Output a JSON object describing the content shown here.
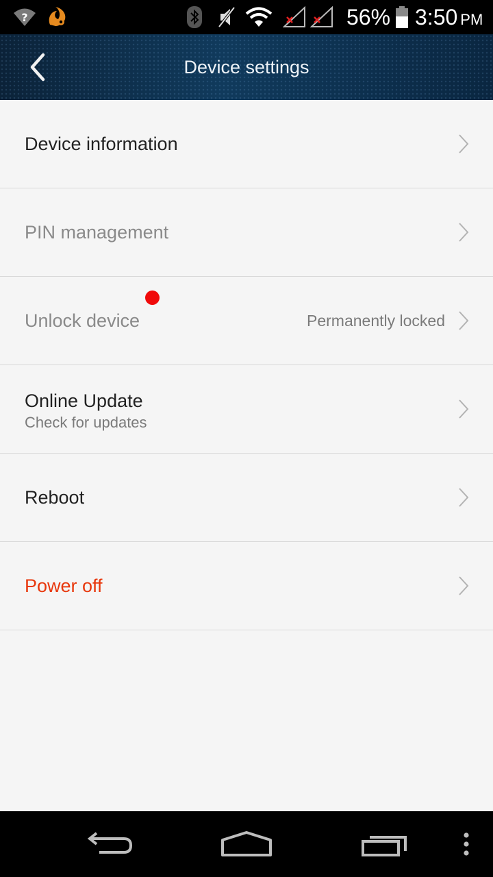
{
  "status_bar": {
    "battery_percent": "56%",
    "time": "3:50",
    "ampm": "PM",
    "icons": [
      "wifi-question-icon",
      "uc-browser-icon",
      "bluetooth-icon",
      "mute-icon",
      "wifi-icon",
      "signal-no-service-icon",
      "signal-no-service-icon",
      "battery-icon"
    ]
  },
  "header": {
    "title": "Device settings",
    "back_icon": "back-chevron-icon"
  },
  "menu": {
    "items": [
      {
        "label": "Device information",
        "state": "enabled"
      },
      {
        "label": "PIN management",
        "state": "disabled"
      },
      {
        "label": "Unlock device",
        "value": "Permanently locked",
        "state": "disabled",
        "badge": "red-dot"
      },
      {
        "label": "Online Update",
        "subtitle": "Check for updates",
        "state": "enabled"
      },
      {
        "label": "Reboot",
        "state": "enabled"
      },
      {
        "label": "Power off",
        "state": "danger"
      }
    ]
  },
  "nav_bar": {
    "icons": [
      "back-arrow-icon",
      "home-icon",
      "recent-apps-icon",
      "overflow-menu-icon"
    ]
  },
  "colors": {
    "danger": "#e8380d",
    "badge": "#f00a0a",
    "header_dark": "#0b2238",
    "header_mid": "#103a5c"
  }
}
